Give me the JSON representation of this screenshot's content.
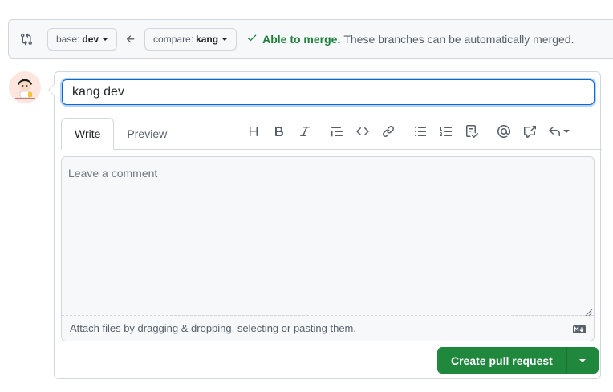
{
  "compare_bar": {
    "base_prefix": "base:",
    "base_branch": "dev",
    "compare_prefix": "compare:",
    "compare_branch": "kang",
    "merge_ok": "Able to merge.",
    "merge_desc": "These branches can be automatically merged."
  },
  "form": {
    "title_value": "kang dev",
    "tabs": [
      {
        "label": "Write",
        "active": true
      },
      {
        "label": "Preview",
        "active": false
      }
    ],
    "toolbar_icons": [
      "heading-icon",
      "bold-icon",
      "italic-icon",
      "quote-icon",
      "code-icon",
      "link-icon",
      "unordered-list-icon",
      "ordered-list-icon",
      "task-list-icon",
      "mention-icon",
      "cross-reference-icon",
      "saved-replies-icon"
    ],
    "comment_placeholder": "Leave a comment",
    "attach_hint": "Attach files by dragging & dropping, selecting or pasting them."
  },
  "actions": {
    "create_label": "Create pull request"
  },
  "colors": {
    "accent_blue": "#0969da",
    "success_green": "#1a7f37",
    "button_green": "#1f883d",
    "border": "#d0d7de",
    "muted_text": "#57606a"
  }
}
